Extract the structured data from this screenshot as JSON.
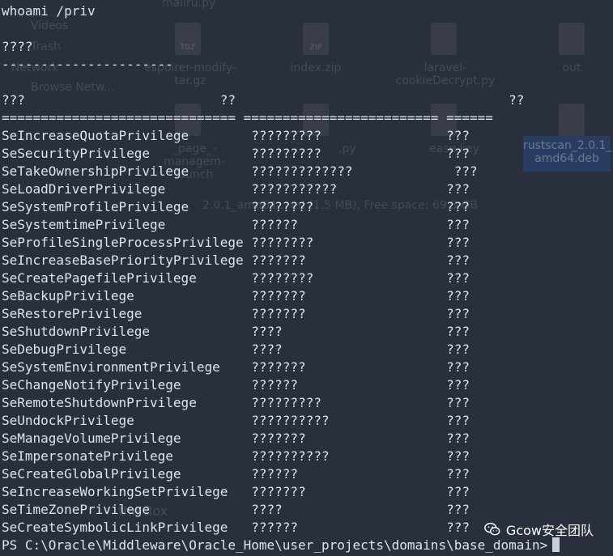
{
  "terminal": {
    "command": "whoami /priv",
    "section_title": "????",
    "section_rule": "----------------------",
    "header": "???                         ??                                   ??",
    "separator": "============================== ========================= ======",
    "privileges": [
      {
        "name": "SeIncreaseQuotaPrivilege",
        "desc": "?????????",
        "state": "???"
      },
      {
        "name": "SeSecurityPrivilege",
        "desc": "?????????",
        "state": "???"
      },
      {
        "name": "SeTakeOwnershipPrivilege",
        "desc": "?????????????",
        "state": "???"
      },
      {
        "name": "SeLoadDriverPrivilege",
        "desc": "???????????",
        "state": "???"
      },
      {
        "name": "SeSystemProfilePrivilege",
        "desc": "????????",
        "state": "???"
      },
      {
        "name": "SeSystemtimePrivilege",
        "desc": "??????",
        "state": "???"
      },
      {
        "name": "SeProfileSingleProcessPrivilege",
        "desc": "????????",
        "state": "???"
      },
      {
        "name": "SeIncreaseBasePriorityPrivilege",
        "desc": "???????",
        "state": "???"
      },
      {
        "name": "SeCreatePagefilePrivilege",
        "desc": "????????",
        "state": "???"
      },
      {
        "name": "SeBackupPrivilege",
        "desc": "???????",
        "state": "???"
      },
      {
        "name": "SeRestorePrivilege",
        "desc": "???????",
        "state": "???"
      },
      {
        "name": "SeShutdownPrivilege",
        "desc": "????",
        "state": "???"
      },
      {
        "name": "SeDebugPrivilege",
        "desc": "????",
        "state": "???"
      },
      {
        "name": "SeSystemEnvironmentPrivilege",
        "desc": "???????",
        "state": "???"
      },
      {
        "name": "SeChangeNotifyPrivilege",
        "desc": "??????",
        "state": "???"
      },
      {
        "name": "SeRemoteShutdownPrivilege",
        "desc": "?????????",
        "state": "???"
      },
      {
        "name": "SeUndockPrivilege",
        "desc": "??????????",
        "state": "???"
      },
      {
        "name": "SeManageVolumePrivilege",
        "desc": "???????",
        "state": "???"
      },
      {
        "name": "SeImpersonatePrivilege",
        "desc": "??????????",
        "state": "???"
      },
      {
        "name": "SeCreateGlobalPrivilege",
        "desc": "??????",
        "state": "???"
      },
      {
        "name": "SeIncreaseWorkingSetPrivilege",
        "desc": "???????",
        "state": "???"
      },
      {
        "name": "SeTimeZonePrivilege",
        "desc": "????",
        "state": "???"
      },
      {
        "name": "SeCreateSymbolicLinkPrivilege",
        "desc": "??????",
        "state": "???"
      }
    ],
    "prompt": "PS C:\\Oracle\\Middleware\\Oracle_Home\\user_projects\\domains\\base_domain>"
  },
  "watermark": {
    "text": "Gcow安全团队",
    "icon": "wechat-icon"
  },
  "desktop_bg": {
    "sidebar": [
      "Videos",
      "Trash",
      "Network",
      "Browse Netw..."
    ],
    "files": [
      {
        "label": "mailru.py"
      },
      {
        "label": "espoirer-modify-\ntar.gz",
        "badge": "TGZ"
      },
      {
        "label": "index.zip",
        "badge": "ZIP"
      },
      {
        "label": "laravel-\ncookieDecrypt.py"
      },
      {
        "label": "out"
      },
      {
        "label": "_page_-\nmanagem-\nlaunch"
      },
      {
        "label": ".py"
      },
      {
        "label": "ease.key"
      },
      {
        "label": "rustscan_2.0.1_\namd64.deb"
      }
    ],
    "status": "2.0.1_amd64... ed (1.5 MB), Free space: 69.3 GB",
    "footer": "the Box"
  },
  "colors": {
    "background": "#2a2f3d",
    "text": "#dfe3ea",
    "cursor": "#c8d0e0",
    "watermark": "#ffffff"
  }
}
